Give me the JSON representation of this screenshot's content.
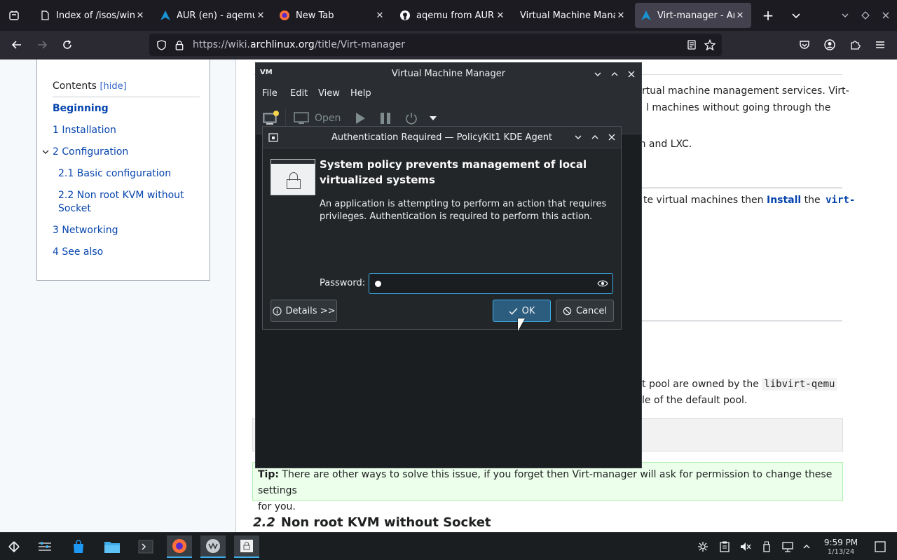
{
  "browser": {
    "tabs": [
      {
        "title": "Index of /isos/win",
        "icon": "document-icon"
      },
      {
        "title": "AUR (en) - aqemu",
        "icon": "arch-icon"
      },
      {
        "title": "New Tab",
        "icon": "firefox-icon"
      },
      {
        "title": "aqemu from AUR",
        "icon": "github-icon"
      },
      {
        "title": "Virtual Machine Mana",
        "icon": "none"
      },
      {
        "title": "Virt-manager - Arc",
        "icon": "arch-icon",
        "active": true
      }
    ],
    "close_glyph": "✕",
    "new_tab_glyph": "+",
    "url_prefix": "https://wiki.",
    "url_domain": "archlinux.org",
    "url_path": "/title/Virt-manager"
  },
  "toc": {
    "title": "Contents",
    "hide": "[hide]",
    "items": [
      {
        "label": "Beginning"
      },
      {
        "label": "1  Installation"
      },
      {
        "label": "2  Configuration"
      },
      {
        "label": "2.1  Basic configuration"
      },
      {
        "label": "2.2  Non root KVM without"
      },
      {
        "label": "Socket"
      },
      {
        "label": "3  Networking"
      },
      {
        "label": "4  See also"
      }
    ]
  },
  "article": {
    "line1": "rtual machine management services. Virt-",
    "line2": "l machines without going through the",
    "line3": "en and LXC.",
    "line4_pre": "te virtual machines then ",
    "line4_link": "Install",
    "line4_mid": " the ",
    "line4_code": "virt-",
    "line5_pre": "t pool are owned by the ",
    "line5_code": "libvirt-qemu",
    "line6": "le of the default pool.",
    "tip_label": "Tip:",
    "tip_text": " There are other ways to solve this issue, if you forget then Virt-manager will ask for permission to change these settings",
    "tip_text2": "for you.",
    "section_num": "2.2",
    "section_title": "Non root KVM without Socket"
  },
  "vmm": {
    "title": "Virtual Machine Manager",
    "logo": "VM",
    "menu": [
      "File",
      "Edit",
      "View",
      "Help"
    ],
    "open_label": "Open"
  },
  "auth": {
    "title": "Authentication Required — PolicyKit1 KDE Agent",
    "heading": "System policy prevents management of local virtualized systems",
    "description": "An application is attempting to perform an action that requires privileges. Authentication is required to perform this action.",
    "password_label": "Password:",
    "details_label": "Details >>",
    "ok_label": "OK",
    "cancel_label": "Cancel"
  },
  "taskbar": {
    "time": "9:59 PM",
    "date": "1/13/24"
  },
  "colors": {
    "accent": "#3daee9",
    "link": "#0645ad",
    "tip_bg": "#ebffeb"
  }
}
